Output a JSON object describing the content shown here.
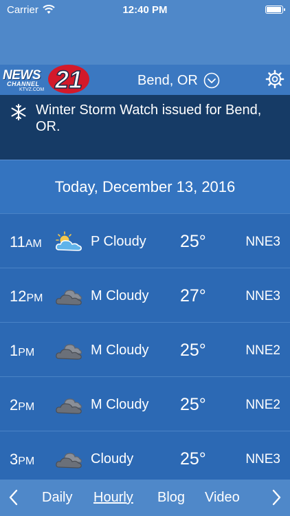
{
  "status_bar": {
    "carrier": "Carrier",
    "time": "12:40 PM",
    "battery_level": 1.0
  },
  "header": {
    "logo_text": "NEWS CHANNEL 21 KTVZ.COM",
    "location": "Bend, OR",
    "icons": [
      "chevron-down-icon",
      "gear-icon"
    ]
  },
  "alert": {
    "icon": "snowflake-icon",
    "text": "Winter Storm Watch issued for Bend, OR."
  },
  "date_heading": "Today, December 13, 2016",
  "forecast": [
    {
      "hour": "11",
      "ampm": "AM",
      "icon": "partly-cloudy-icon",
      "condition": "P Cloudy",
      "temp": "25°",
      "wind": "NNE3"
    },
    {
      "hour": "12",
      "ampm": "PM",
      "icon": "mostly-cloudy-icon",
      "condition": "M Cloudy",
      "temp": "27°",
      "wind": "NNE3"
    },
    {
      "hour": "1",
      "ampm": "PM",
      "icon": "mostly-cloudy-icon",
      "condition": "M Cloudy",
      "temp": "25°",
      "wind": "NNE2"
    },
    {
      "hour": "2",
      "ampm": "PM",
      "icon": "mostly-cloudy-icon",
      "condition": "M Cloudy",
      "temp": "25°",
      "wind": "NNE2"
    },
    {
      "hour": "3",
      "ampm": "PM",
      "icon": "cloudy-icon",
      "condition": "Cloudy",
      "temp": "25°",
      "wind": "NNE3"
    }
  ],
  "bottom_nav": {
    "prev_icon": "chevron-left-icon",
    "next_icon": "chevron-right-icon",
    "items": [
      "Daily",
      "Hourly",
      "Blog",
      "Video"
    ],
    "active": "Hourly"
  },
  "colors": {
    "header_blue": "#4f88c9",
    "alert_navy": "#163b66",
    "row_blue": "#2c69b4"
  }
}
